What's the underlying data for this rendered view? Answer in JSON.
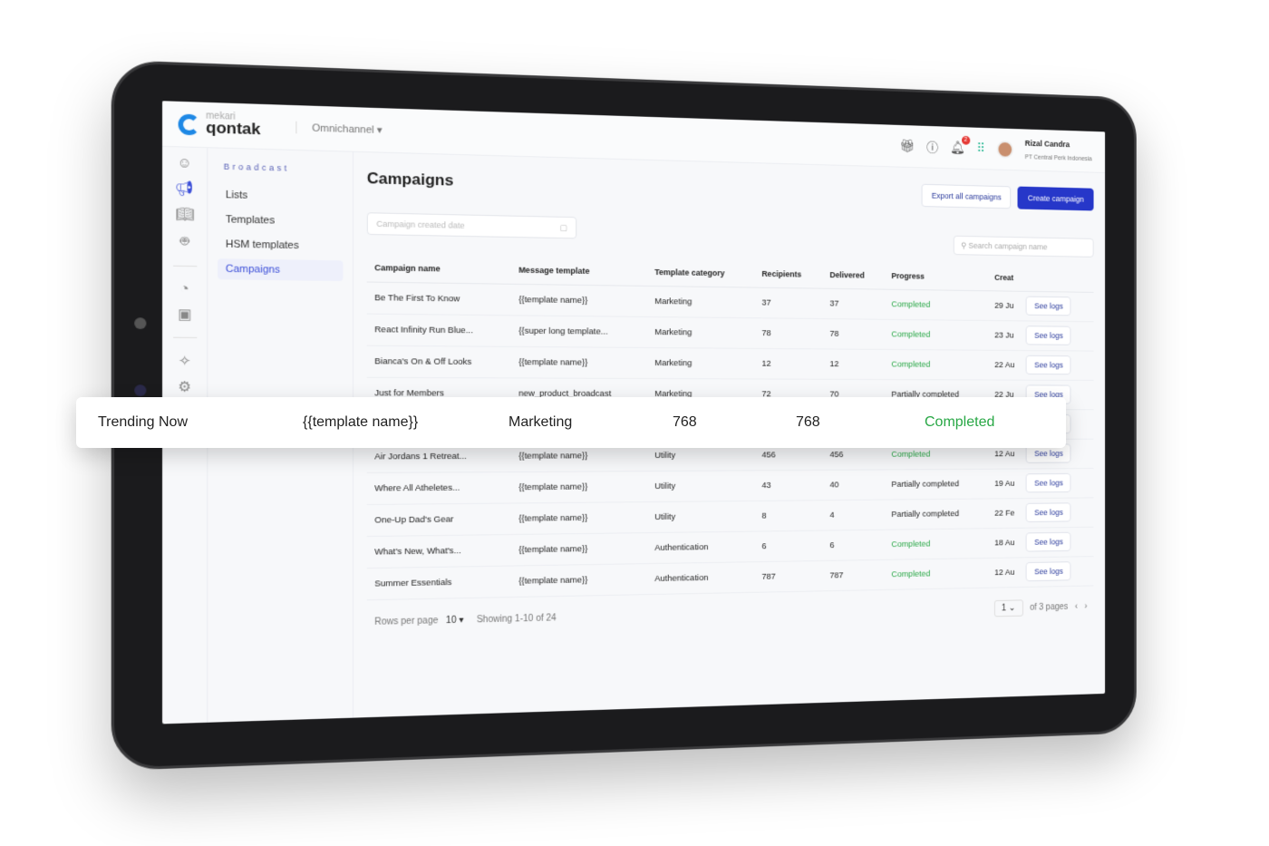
{
  "header": {
    "brand_top": "mekari",
    "brand": "qontak",
    "workspace": "Omnichannel",
    "notifications": "2",
    "user_name": "Rizal Candra",
    "company": "PT Central Perk Indonesia"
  },
  "sidebar": {
    "section": "Broadcast",
    "items": [
      {
        "label": "Lists"
      },
      {
        "label": "Templates"
      },
      {
        "label": "HSM templates"
      },
      {
        "label": "Campaigns",
        "active": true
      }
    ]
  },
  "page": {
    "title": "Campaigns",
    "export_label": "Export all campaigns",
    "create_label": "Create campaign",
    "date_placeholder": "Campaign created date",
    "search_placeholder": "Search campaign name"
  },
  "table": {
    "columns": [
      "Campaign name",
      "Message template",
      "Template category",
      "Recipients",
      "Delivered",
      "Progress",
      "Creat"
    ],
    "action_label": "See logs",
    "rows": [
      [
        "Be The First To Know",
        "{{template name}}",
        "Marketing",
        "37",
        "37",
        "Completed",
        "29 Ju"
      ],
      [
        "React Infinity Run Blue...",
        "{{super long template...",
        "Marketing",
        "78",
        "78",
        "Completed",
        "23 Ju"
      ],
      [
        "Bianca's On & Off Looks",
        "{{template name}}",
        "Marketing",
        "12",
        "12",
        "Completed",
        "22 Au"
      ],
      [
        "Just for Members",
        "new_product_broadcast",
        "Marketing",
        "72",
        "70",
        "Partially completed",
        "22 Ju"
      ],
      [
        "Trending Now",
        "{{template name}}",
        "Marketing",
        "768",
        "768",
        "Completed",
        ""
      ],
      [
        "Air Jordans 1 Retreat...",
        "{{template name}}",
        "Utility",
        "456",
        "456",
        "Completed",
        "12 Au"
      ],
      [
        "Where All Atheletes...",
        "{{template name}}",
        "Utility",
        "43",
        "40",
        "Partially completed",
        "19 Au"
      ],
      [
        "One-Up Dad's Gear",
        "{{template name}}",
        "Utility",
        "8",
        "4",
        "Partially completed",
        "22 Fe"
      ],
      [
        "What's New, What's...",
        "{{template name}}",
        "Authentication",
        "6",
        "6",
        "Completed",
        "18 Au"
      ],
      [
        "Summer Essentials",
        "{{template name}}",
        "Authentication",
        "787",
        "787",
        "Completed",
        "12 Au"
      ]
    ]
  },
  "pagination": {
    "rows_label": "Rows per page",
    "rows_value": "10",
    "showing": "Showing 1-10 of 24",
    "page": "1",
    "of_pages": "of 3 pages"
  },
  "highlight": {
    "name": "Trending Now",
    "template": "{{template name}}",
    "category": "Marketing",
    "recipients": "768",
    "delivered": "768",
    "progress": "Completed"
  },
  "colors": {
    "accent": "#2637c9",
    "completed": "#28a745"
  }
}
